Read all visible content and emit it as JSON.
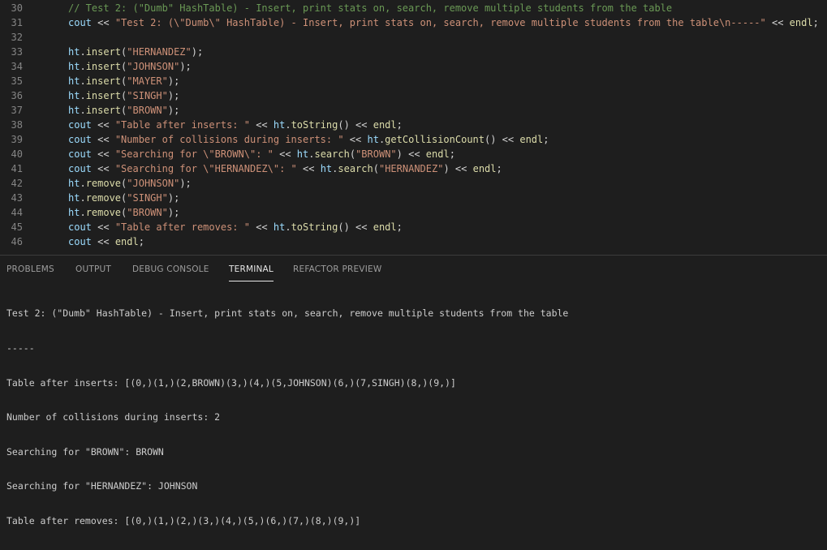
{
  "editor": {
    "lines": [
      {
        "num": "30",
        "tokens": [
          {
            "t": "// Test 2: (\"Dumb\" HashTable) - Insert, print stats on, search, remove multiple students from the table",
            "c": "t-comment"
          }
        ]
      },
      {
        "num": "31",
        "tokens": [
          {
            "t": "cout",
            "c": "t-var"
          },
          {
            "t": " << ",
            "c": "t-op"
          },
          {
            "t": "\"Test 2: (\\\"Dumb\\\" HashTable) - Insert, print stats on, search, remove multiple students from the table\\n-----\"",
            "c": "t-str"
          },
          {
            "t": " << ",
            "c": "t-op"
          },
          {
            "t": "endl",
            "c": "t-fn"
          },
          {
            "t": ";",
            "c": "t-op"
          }
        ]
      },
      {
        "num": "32",
        "tokens": []
      },
      {
        "num": "33",
        "tokens": [
          {
            "t": "ht",
            "c": "t-var"
          },
          {
            "t": ".",
            "c": "t-op"
          },
          {
            "t": "insert",
            "c": "t-fn"
          },
          {
            "t": "(",
            "c": "t-op"
          },
          {
            "t": "\"HERNANDEZ\"",
            "c": "t-str"
          },
          {
            "t": ");",
            "c": "t-op"
          }
        ]
      },
      {
        "num": "34",
        "tokens": [
          {
            "t": "ht",
            "c": "t-var"
          },
          {
            "t": ".",
            "c": "t-op"
          },
          {
            "t": "insert",
            "c": "t-fn"
          },
          {
            "t": "(",
            "c": "t-op"
          },
          {
            "t": "\"JOHNSON\"",
            "c": "t-str"
          },
          {
            "t": ");",
            "c": "t-op"
          }
        ]
      },
      {
        "num": "35",
        "tokens": [
          {
            "t": "ht",
            "c": "t-var"
          },
          {
            "t": ".",
            "c": "t-op"
          },
          {
            "t": "insert",
            "c": "t-fn"
          },
          {
            "t": "(",
            "c": "t-op"
          },
          {
            "t": "\"MAYER\"",
            "c": "t-str"
          },
          {
            "t": ");",
            "c": "t-op"
          }
        ]
      },
      {
        "num": "36",
        "tokens": [
          {
            "t": "ht",
            "c": "t-var"
          },
          {
            "t": ".",
            "c": "t-op"
          },
          {
            "t": "insert",
            "c": "t-fn"
          },
          {
            "t": "(",
            "c": "t-op"
          },
          {
            "t": "\"SINGH\"",
            "c": "t-str"
          },
          {
            "t": ");",
            "c": "t-op"
          }
        ]
      },
      {
        "num": "37",
        "tokens": [
          {
            "t": "ht",
            "c": "t-var"
          },
          {
            "t": ".",
            "c": "t-op"
          },
          {
            "t": "insert",
            "c": "t-fn"
          },
          {
            "t": "(",
            "c": "t-op"
          },
          {
            "t": "\"BROWN\"",
            "c": "t-str"
          },
          {
            "t": ");",
            "c": "t-op"
          }
        ]
      },
      {
        "num": "38",
        "tokens": [
          {
            "t": "cout",
            "c": "t-var"
          },
          {
            "t": " << ",
            "c": "t-op"
          },
          {
            "t": "\"Table after inserts: \"",
            "c": "t-str"
          },
          {
            "t": " << ",
            "c": "t-op"
          },
          {
            "t": "ht",
            "c": "t-var"
          },
          {
            "t": ".",
            "c": "t-op"
          },
          {
            "t": "toString",
            "c": "t-fn"
          },
          {
            "t": "()",
            "c": "t-op"
          },
          {
            "t": " << ",
            "c": "t-op"
          },
          {
            "t": "endl",
            "c": "t-fn"
          },
          {
            "t": ";",
            "c": "t-op"
          }
        ]
      },
      {
        "num": "39",
        "tokens": [
          {
            "t": "cout",
            "c": "t-var"
          },
          {
            "t": " << ",
            "c": "t-op"
          },
          {
            "t": "\"Number of collisions during inserts: \"",
            "c": "t-str"
          },
          {
            "t": " << ",
            "c": "t-op"
          },
          {
            "t": "ht",
            "c": "t-var"
          },
          {
            "t": ".",
            "c": "t-op"
          },
          {
            "t": "getCollisionCount",
            "c": "t-fn"
          },
          {
            "t": "()",
            "c": "t-op"
          },
          {
            "t": " << ",
            "c": "t-op"
          },
          {
            "t": "endl",
            "c": "t-fn"
          },
          {
            "t": ";",
            "c": "t-op"
          }
        ]
      },
      {
        "num": "40",
        "tokens": [
          {
            "t": "cout",
            "c": "t-var"
          },
          {
            "t": " << ",
            "c": "t-op"
          },
          {
            "t": "\"Searching for \\\"BROWN\\\": \"",
            "c": "t-str"
          },
          {
            "t": " << ",
            "c": "t-op"
          },
          {
            "t": "ht",
            "c": "t-var"
          },
          {
            "t": ".",
            "c": "t-op"
          },
          {
            "t": "search",
            "c": "t-fn"
          },
          {
            "t": "(",
            "c": "t-op"
          },
          {
            "t": "\"BROWN\"",
            "c": "t-str"
          },
          {
            "t": ")",
            "c": "t-op"
          },
          {
            "t": " << ",
            "c": "t-op"
          },
          {
            "t": "endl",
            "c": "t-fn"
          },
          {
            "t": ";",
            "c": "t-op"
          }
        ]
      },
      {
        "num": "41",
        "tokens": [
          {
            "t": "cout",
            "c": "t-var"
          },
          {
            "t": " << ",
            "c": "t-op"
          },
          {
            "t": "\"Searching for \\\"HERNANDEZ\\\": \"",
            "c": "t-str"
          },
          {
            "t": " << ",
            "c": "t-op"
          },
          {
            "t": "ht",
            "c": "t-var"
          },
          {
            "t": ".",
            "c": "t-op"
          },
          {
            "t": "search",
            "c": "t-fn"
          },
          {
            "t": "(",
            "c": "t-op"
          },
          {
            "t": "\"HERNANDEZ\"",
            "c": "t-str"
          },
          {
            "t": ")",
            "c": "t-op"
          },
          {
            "t": " << ",
            "c": "t-op"
          },
          {
            "t": "endl",
            "c": "t-fn"
          },
          {
            "t": ";",
            "c": "t-op"
          }
        ]
      },
      {
        "num": "42",
        "tokens": [
          {
            "t": "ht",
            "c": "t-var"
          },
          {
            "t": ".",
            "c": "t-op"
          },
          {
            "t": "remove",
            "c": "t-fn"
          },
          {
            "t": "(",
            "c": "t-op"
          },
          {
            "t": "\"JOHNSON\"",
            "c": "t-str"
          },
          {
            "t": ");",
            "c": "t-op"
          }
        ]
      },
      {
        "num": "43",
        "tokens": [
          {
            "t": "ht",
            "c": "t-var"
          },
          {
            "t": ".",
            "c": "t-op"
          },
          {
            "t": "remove",
            "c": "t-fn"
          },
          {
            "t": "(",
            "c": "t-op"
          },
          {
            "t": "\"SINGH\"",
            "c": "t-str"
          },
          {
            "t": ");",
            "c": "t-op"
          }
        ]
      },
      {
        "num": "44",
        "tokens": [
          {
            "t": "ht",
            "c": "t-var"
          },
          {
            "t": ".",
            "c": "t-op"
          },
          {
            "t": "remove",
            "c": "t-fn"
          },
          {
            "t": "(",
            "c": "t-op"
          },
          {
            "t": "\"BROWN\"",
            "c": "t-str"
          },
          {
            "t": ");",
            "c": "t-op"
          }
        ]
      },
      {
        "num": "45",
        "tokens": [
          {
            "t": "cout",
            "c": "t-var"
          },
          {
            "t": " << ",
            "c": "t-op"
          },
          {
            "t": "\"Table after removes: \"",
            "c": "t-str"
          },
          {
            "t": " << ",
            "c": "t-op"
          },
          {
            "t": "ht",
            "c": "t-var"
          },
          {
            "t": ".",
            "c": "t-op"
          },
          {
            "t": "toString",
            "c": "t-fn"
          },
          {
            "t": "()",
            "c": "t-op"
          },
          {
            "t": " << ",
            "c": "t-op"
          },
          {
            "t": "endl",
            "c": "t-fn"
          },
          {
            "t": ";",
            "c": "t-op"
          }
        ]
      },
      {
        "num": "46",
        "tokens": [
          {
            "t": "cout",
            "c": "t-var"
          },
          {
            "t": " << ",
            "c": "t-op"
          },
          {
            "t": "endl",
            "c": "t-fn"
          },
          {
            "t": ";",
            "c": "t-op"
          }
        ]
      }
    ]
  },
  "panel": {
    "tabs": [
      {
        "label": "PROBLEMS",
        "active": false
      },
      {
        "label": "OUTPUT",
        "active": false
      },
      {
        "label": "DEBUG CONSOLE",
        "active": false
      },
      {
        "label": "TERMINAL",
        "active": true
      },
      {
        "label": "REFACTOR PREVIEW",
        "active": false
      }
    ],
    "terminal_lines": [
      "Test 2: (\"Dumb\" HashTable) - Insert, print stats on, search, remove multiple students from the table",
      "-----",
      "Table after inserts: [(0,)(1,)(2,BROWN)(3,)(4,)(5,JOHNSON)(6,)(7,SINGH)(8,)(9,)]",
      "Number of collisions during inserts: 2",
      "Searching for \"BROWN\": BROWN",
      "Searching for \"HERNANDEZ\": JOHNSON",
      "Table after removes: [(0,)(1,)(2,)(3,)(4,)(5,)(6,)(7,)(8,)(9,)]"
    ]
  }
}
